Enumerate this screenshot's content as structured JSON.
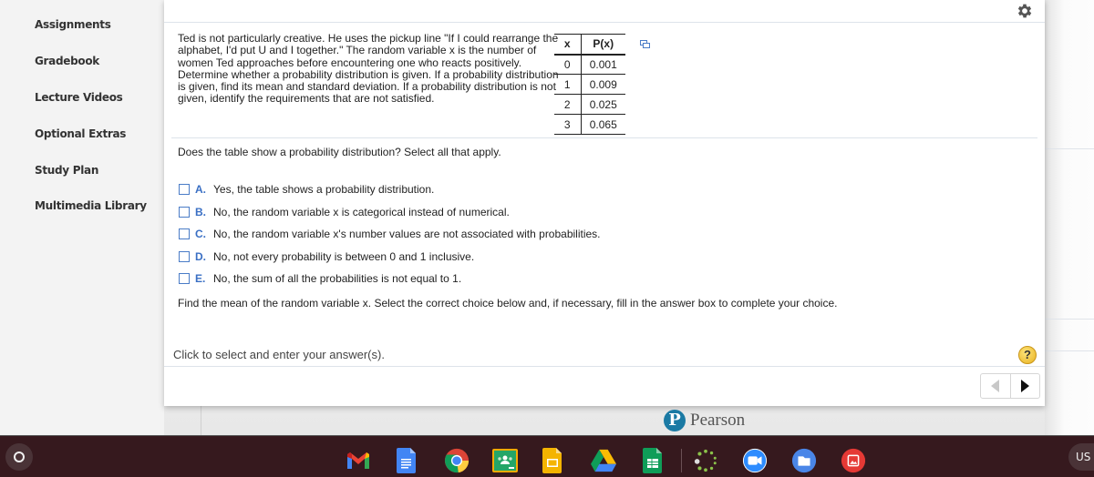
{
  "sidebar": {
    "items": [
      {
        "label": "Assignments"
      },
      {
        "label": "Gradebook"
      },
      {
        "label": "Lecture Videos"
      },
      {
        "label": "Optional Extras"
      },
      {
        "label": "Study Plan"
      },
      {
        "label": "Multimedia Library"
      }
    ]
  },
  "question": {
    "text": "Ted is not particularly creative. He uses the pickup line \"If I could rearrange the alphabet, I'd put U and I together.\" The random variable x is the number of women Ted approaches before encountering one who reacts positively. Determine whether a probability distribution is given. If a probability distribution is given, find its mean and standard deviation. If a probability distribution is not given, identify the requirements that are not satisfied.",
    "table": {
      "headers": [
        "x",
        "P(x)"
      ],
      "rows": [
        [
          "0",
          "0.001"
        ],
        [
          "1",
          "0.009"
        ],
        [
          "2",
          "0.025"
        ],
        [
          "3",
          "0.065"
        ]
      ]
    },
    "prompt": "Does the table show a probability distribution? Select all that apply.",
    "options": [
      {
        "letter": "A.",
        "text": "Yes, the table shows a probability distribution.",
        "checked": false
      },
      {
        "letter": "B.",
        "text": "No, the random variable x is categorical instead of numerical.",
        "checked": false
      },
      {
        "letter": "C.",
        "text": "No, the random variable x's number values are not associated with probabilities.",
        "checked": false
      },
      {
        "letter": "D.",
        "text": "No, not every probability is between 0 and 1 inclusive.",
        "checked": false
      },
      {
        "letter": "E.",
        "text": "No, the sum of all the probabilities is not equal to 1.",
        "checked": false
      }
    ],
    "mean_prompt": "Find the mean of the random variable x. Select the correct choice below and, if necessary, fill in the answer box to complete your choice."
  },
  "footer": {
    "answer_hint": "Click to select and enter your answer(s).",
    "help_label": "?",
    "brand": "Pearson",
    "brand_initial": "P"
  },
  "icons": {
    "settings": "gear-icon",
    "popout": "popout-icon",
    "help": "help-icon",
    "prev": "chevron-left-icon",
    "next": "chevron-right-icon"
  },
  "shelf": {
    "apps": [
      "Gmail",
      "Google Docs",
      "Google Chrome",
      "Google Classroom",
      "Google Slides",
      "Google Drive",
      "Google Sheets",
      "Loading app",
      "Zoom",
      "Files",
      "Gallery"
    ],
    "tray_text": "US"
  },
  "colors": {
    "option_letter": "#3a6fc4",
    "pearson_blue": "#1b7aa4",
    "shelf_bg": "#36191e",
    "help_yellow": "#e9b221"
  }
}
